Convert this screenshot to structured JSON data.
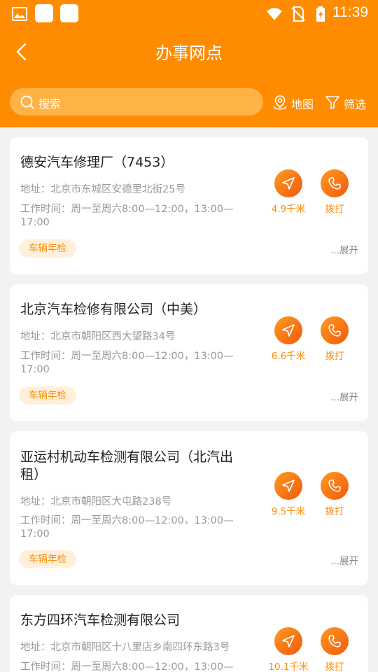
{
  "status_bar": {
    "time": "11:39"
  },
  "header": {
    "title": "办事网点"
  },
  "search": {
    "placeholder": "搜索"
  },
  "toolbar": {
    "map_label": "地图",
    "filter_label": "筛选"
  },
  "accent_color": "#ff8c00",
  "cards": [
    {
      "name": "德安汽车修理厂（7453）",
      "address": "地址：北京市东城区安德里北街25号",
      "hours": "工作时间：周一至周六8:00—12:00，13:00—17:00",
      "tag": "车辆年检",
      "distance": "4.9千米",
      "call_label": "拨打",
      "expand_label": "...展开"
    },
    {
      "name": "北京汽车检修有限公司（中美）",
      "address": "地址：北京市朝阳区西大望路34号",
      "hours": "工作时间：周一至周六8:00—12:00，13:00—17:00",
      "tag": "车辆年检",
      "distance": "6.6千米",
      "call_label": "拨打",
      "expand_label": "...展开"
    },
    {
      "name": "亚运村机动车检测有限公司（北汽出租）",
      "address": "地址：北京市朝阳区大屯路238号",
      "hours": "工作时间：周一至周六8:00—12:00，13:00—17:00",
      "tag": "车辆年检",
      "distance": "9.5千米",
      "call_label": "拨打",
      "expand_label": "...展开"
    },
    {
      "name": "东方四环汽车检测有限公司",
      "address": "地址：北京市朝阳区十八里店乡南四环东路3号",
      "hours": "工作时间：周一至周六8:00—12:00，13:00—",
      "distance": "10.1千米",
      "call_label": "拨打"
    }
  ]
}
